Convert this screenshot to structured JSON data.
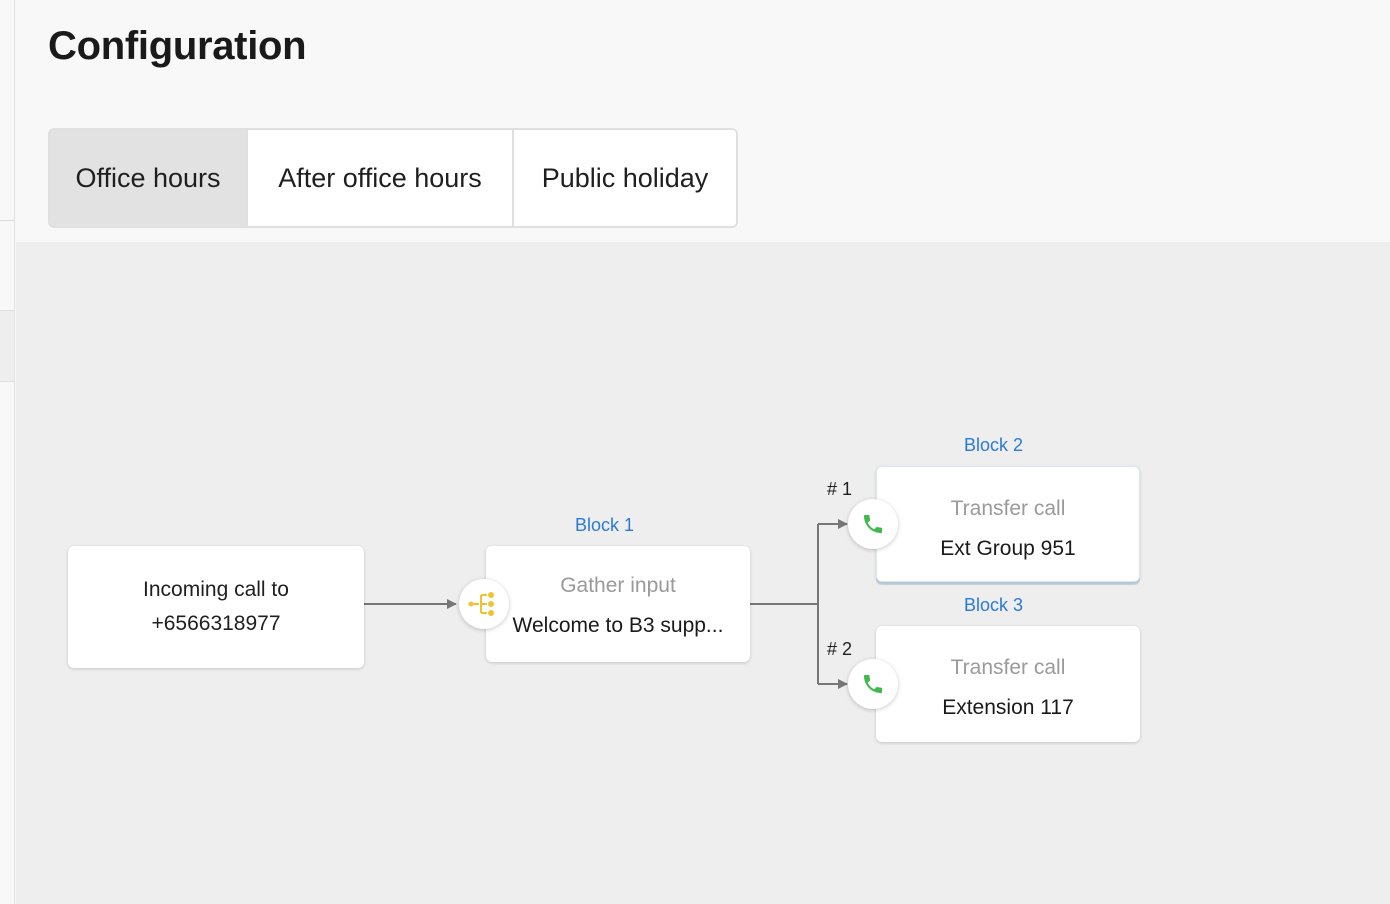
{
  "page": {
    "title": "Configuration"
  },
  "tabs": [
    {
      "label": "Office hours",
      "active": true
    },
    {
      "label": "After office hours",
      "active": false
    },
    {
      "label": "Public holiday",
      "active": false
    }
  ],
  "flow": {
    "incoming": {
      "line1": "Incoming call to",
      "line2": "+6566318977"
    },
    "block1": {
      "label": "Block 1",
      "type": "Gather input",
      "value": "Welcome to B3 supp...",
      "icon": "gather-input-icon",
      "icon_color": "#f2c230"
    },
    "branches": [
      {
        "key": "# 1",
        "block_label": "Block 2",
        "type": "Transfer call",
        "value": "Ext Group 951",
        "icon": "phone-icon"
      },
      {
        "key": "# 2",
        "block_label": "Block 3",
        "type": "Transfer call",
        "value": "Extension 117",
        "icon": "phone-icon"
      }
    ]
  },
  "colors": {
    "accent": "#2a7ad6",
    "phone": "#3fb94a",
    "canvas": "#eeeeee",
    "edge": "#777777"
  }
}
